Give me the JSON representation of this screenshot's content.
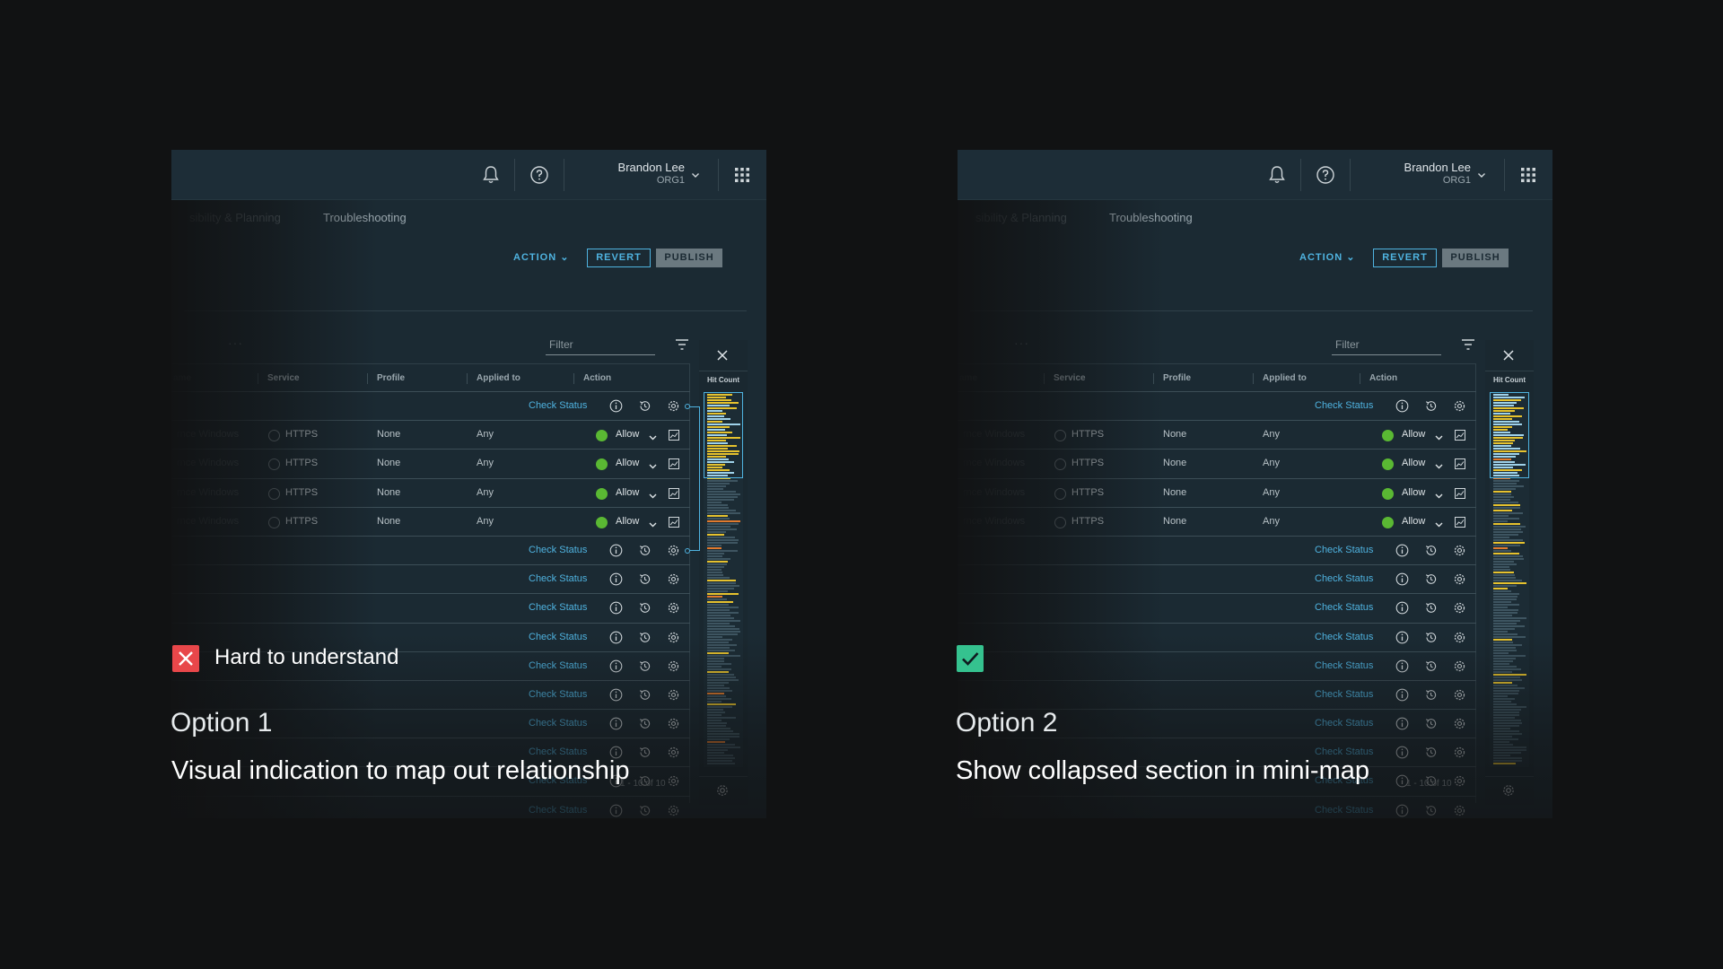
{
  "colors": {
    "background": "#111213",
    "panel": "#1b2a33",
    "accent": "#4fb3e0",
    "allow": "#5ab833",
    "bad": "#e8474a",
    "good": "#35c28f",
    "yellow": "#e6c22e",
    "orange": "#e07a2e"
  },
  "panels": [
    {
      "user": {
        "name": "Brandon Lee",
        "org": "ORG1"
      },
      "nav": [
        "sibility & Planning",
        "Troubleshooting"
      ],
      "actions": {
        "action": "ACTION",
        "revert": "REVERT",
        "publish": "PUBLISH"
      },
      "filter_placeholder": "Filter",
      "columns": [
        "ame",
        "Service",
        "Profile",
        "Applied to",
        "Action"
      ],
      "rules": [
        {
          "name": "rnce Windows",
          "service": "HTTPS",
          "profile": "None",
          "applied": "Any",
          "action": "Allow"
        },
        {
          "name": "rnce Windows",
          "service": "HTTPS",
          "profile": "None",
          "applied": "Any",
          "action": "Allow"
        },
        {
          "name": "rnce Windows",
          "service": "HTTPS",
          "profile": "None",
          "applied": "Any",
          "action": "Allow"
        },
        {
          "name": "rnce Windows",
          "service": "HTTPS",
          "profile": "None",
          "applied": "Any",
          "action": "Allow"
        }
      ],
      "check_label": "Check Status",
      "pager": "1 - 10 of 10",
      "minimap": {
        "header": "Hit Count",
        "expanded": false
      },
      "verdict": {
        "ok": false,
        "text": "Hard to understand"
      },
      "title": "Option 1",
      "desc": "Visual indication to map out relationship"
    },
    {
      "user": {
        "name": "Brandon Lee",
        "org": "ORG1"
      },
      "nav": [
        "sibility & Planning",
        "Troubleshooting"
      ],
      "actions": {
        "action": "ACTION",
        "revert": "REVERT",
        "publish": "PUBLISH"
      },
      "filter_placeholder": "Filter",
      "columns": [
        "ame",
        "Service",
        "Profile",
        "Applied to",
        "Action"
      ],
      "rules": [
        {
          "name": "rnce Windows",
          "service": "HTTPS",
          "profile": "None",
          "applied": "Any",
          "action": "Allow"
        },
        {
          "name": "rnce Windows",
          "service": "HTTPS",
          "profile": "None",
          "applied": "Any",
          "action": "Allow"
        },
        {
          "name": "rnce Windows",
          "service": "HTTPS",
          "profile": "None",
          "applied": "Any",
          "action": "Allow"
        },
        {
          "name": "rnce Windows",
          "service": "HTTPS",
          "profile": "None",
          "applied": "Any",
          "action": "Allow"
        }
      ],
      "check_label": "Check Status",
      "pager": "1 - 10 of 10",
      "minimap": {
        "header": "Hit Count",
        "expanded": true
      },
      "verdict": {
        "ok": true,
        "text": ""
      },
      "title": "Option 2",
      "desc": "Show collapsed section in mini-map"
    }
  ]
}
